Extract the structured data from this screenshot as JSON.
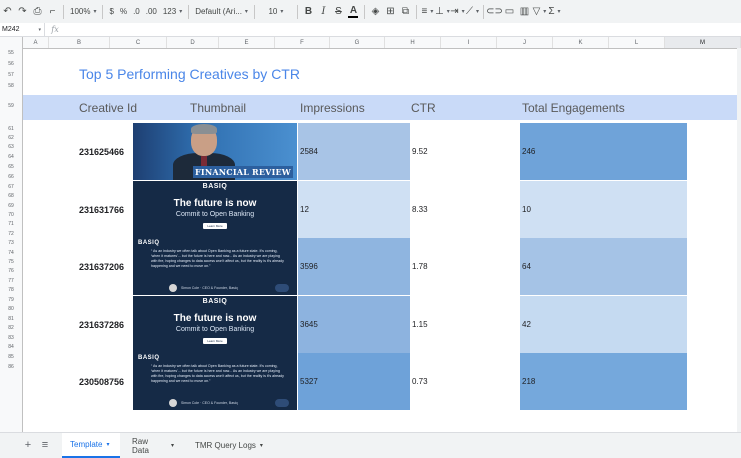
{
  "toolbar": {
    "zoom": "100%",
    "currency": "$",
    "percent": "%",
    "dec_decrease": ".0",
    "dec_increase": ".00",
    "number_format": "123",
    "font": "Default (Ari...",
    "font_size": "10",
    "bold": "B",
    "italic": "I",
    "strike": "S",
    "text_color": "A",
    "sum": "Σ"
  },
  "formula_bar": {
    "cell": "M242",
    "fx": "fx",
    "value": ""
  },
  "columns": [
    "A",
    "B",
    "C",
    "D",
    "E",
    "F",
    "G",
    "H",
    "I",
    "J",
    "K",
    "L",
    "M"
  ],
  "selected_column": "M",
  "rows": [
    "55",
    "56",
    "57",
    "58",
    "59",
    "61",
    "62",
    "63",
    "64",
    "65",
    "66",
    "67",
    "68",
    "69",
    "70",
    "71",
    "72",
    "73",
    "74",
    "75",
    "76",
    "77",
    "78",
    "79",
    "80",
    "81",
    "82",
    "83",
    "84",
    "85",
    "86"
  ],
  "title": "Top 5 Performing Creatives by CTR",
  "headers": {
    "creative_id": "Creative Id",
    "thumbnail": "Thumbnail",
    "impressions": "Impressions",
    "ctr": "CTR",
    "engagements": "Total Engagements"
  },
  "records": [
    {
      "id": "231625466",
      "impressions": "2584",
      "ctr": "9.52",
      "engagements": "246",
      "thumb": "financial-review-photo",
      "imp_color": "#a8c4e6",
      "eng_color": "#6fa3d9"
    },
    {
      "id": "231631766",
      "impressions": "12",
      "ctr": "8.33",
      "engagements": "10",
      "thumb": "open-banking-ad",
      "imp_color": "#cfe0f3",
      "eng_color": "#cfe0f3"
    },
    {
      "id": "231637206",
      "impressions": "3596",
      "ctr": "1.78",
      "engagements": "64",
      "thumb": "quote-card",
      "imp_color": "#8fb5e0",
      "eng_color": "#a5c3e6"
    },
    {
      "id": "231637286",
      "impressions": "3645",
      "ctr": "1.15",
      "engagements": "42",
      "thumb": "open-banking-ad",
      "imp_color": "#8db3df",
      "eng_color": "#c5daf1"
    },
    {
      "id": "230508756",
      "impressions": "5327",
      "ctr": "0.73",
      "engagements": "218",
      "thumb": "quote-card",
      "imp_color": "#6ea2d9",
      "eng_color": "#75a8dc"
    }
  ],
  "thumbs": {
    "financial_review": "FINANCIAL REVIEW",
    "brand": "BASIQ",
    "headline": "The future is now",
    "subhead": "Commit to Open Banking",
    "cta": "Learn More",
    "quote": "“ As an industry we often talk about Open Banking as a future state. It's coming, 'when it matures'... but the future is here and now... As an industry we are playing with fire, hoping changes to data access won't affect us, but the reality is it's already happening and we need to move on.”",
    "quote_author": "Simon Cole · CEO & Founder, Basiq"
  },
  "sheet_tabs": [
    {
      "label": "Template",
      "active": true
    },
    {
      "label": "Raw Data",
      "active": false
    },
    {
      "label": "TMR Query Logs",
      "active": false
    }
  ],
  "sheet_buttons": {
    "add": "+",
    "menu": "≡"
  }
}
